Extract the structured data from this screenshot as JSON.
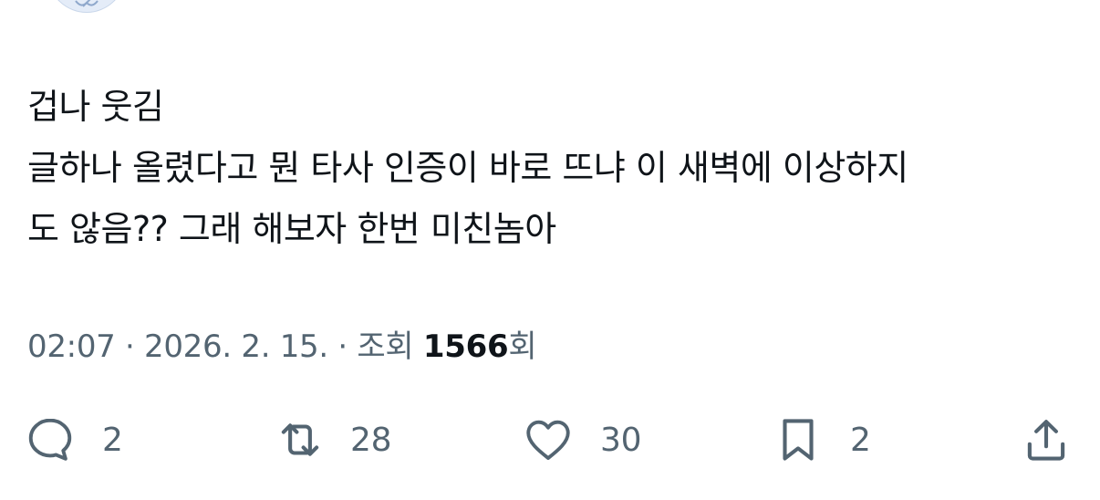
{
  "tweet": {
    "lines": [
      "겁나 웃김",
      "글하나 올렸다고 뭔 타사 인증이 바로 뜨냐 이 새벽에 이상하지",
      "도 않음?? 그래 해보자 한번 미친놈아"
    ]
  },
  "meta": {
    "time": "02:07",
    "separator1": " · ",
    "date": "2026. 2. 15.",
    "separator2": " · ",
    "views_label": "조회 ",
    "views_count": "1566",
    "views_suffix": "회"
  },
  "actions": {
    "reply": {
      "icon": "reply-icon",
      "count": "2"
    },
    "retweet": {
      "icon": "retweet-icon",
      "count": "28"
    },
    "like": {
      "icon": "heart-icon",
      "count": "30"
    },
    "bookmark": {
      "icon": "bookmark-icon",
      "count": "2"
    },
    "share": {
      "icon": "share-icon"
    }
  },
  "colors": {
    "text": "#0f1419",
    "secondary": "#536471",
    "background": "#ffffff"
  }
}
